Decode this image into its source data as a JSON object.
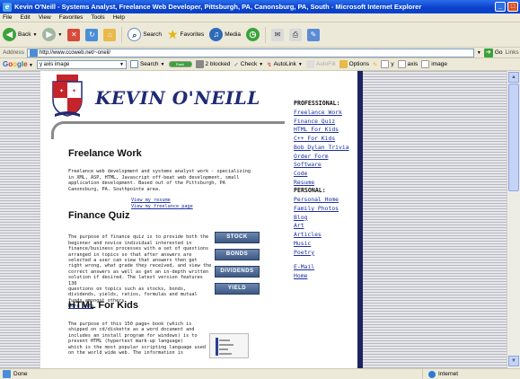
{
  "window": {
    "title": "Kevin O'Neill - Systems Analyst, Freelance Web Developer, Pittsburgh, PA, Canonsburg, PA, South - Microsoft Internet Explorer",
    "buttons": [
      "_",
      "□"
    ]
  },
  "menu": [
    "File",
    "Edit",
    "View",
    "Favorites",
    "Tools",
    "Help"
  ],
  "toolbar": {
    "back": "Back",
    "search": "Search",
    "favorites": "Favorites",
    "media": "Media"
  },
  "address": {
    "label": "Address",
    "url": "http://www.ccoweb.net/~oneil/",
    "go": "Go",
    "links": "Links"
  },
  "google": {
    "logo": "Google",
    "query": "y axis image",
    "search": "Search",
    "rank": "Rank",
    "blocked": "2 blocked",
    "check": "Check",
    "autolink": "AutoLink",
    "autofill": "AutoFill",
    "options": "Options",
    "term1": "y",
    "term2": "axis",
    "term3": "image"
  },
  "site": {
    "title": "KEVIN O'NEILL",
    "sections": [
      {
        "heading": "Freelance Work",
        "text": "Freelance web development and systems analyst work - specializing\nin XML, ASP, HTML, Javascript off-beat web development, small\napplication development. Based out of the Pittsburgh, PA\nCanonsburg, PA. Southpointe area.",
        "links": [
          "View my resume",
          "View my freelance page"
        ]
      },
      {
        "heading": "Finance Quiz",
        "text": "The purpose of finance quiz is to provide both the\nbeginner and novice individual interested in\nfinance/business processes with a set of questions\narranged in topics so that after answers are\nselected a user can view that answers then get\nright wrong, what grade they received, and view the\ncorrect answers as well as get an in-depth written\nsolution if desired. The latest version features 130\nquestions on topics such as stocks, bonds,\ndividends, yields, ratios, formulas and mutual\nfunds amongst others.",
        "more": "More info",
        "buttons": [
          "STOCK",
          "BONDS",
          "DIVIDENDS",
          "YIELD"
        ]
      },
      {
        "heading": "HTML For Kids",
        "text": "The purpose of this 150 page+ book (which is\nshipped on cd/diskette as a word document and\nincludes an install program for windows) is to\npresent HTML (hypertext mark-up language)\nwhich is the most popular scripting language used\non the world wide web. The information is"
      }
    ]
  },
  "sidebar": {
    "professional_heading": "PROFESSIONAL:",
    "professional": [
      "Freelance Work",
      "Finance Quiz",
      "HTML For Kids",
      "C++ For Kids",
      "Bob Dylan Trivia",
      "Order Form",
      "Software",
      "Code",
      "Resume"
    ],
    "personal_heading": "PERSONAL:",
    "personal": [
      "Personal Home",
      "Family Photos",
      "Blog",
      "Art",
      "Articles",
      "Music",
      "Poetry"
    ],
    "other": [
      "E-Mail",
      "Home"
    ]
  },
  "status": {
    "left": "Done",
    "zone": "Internet"
  }
}
